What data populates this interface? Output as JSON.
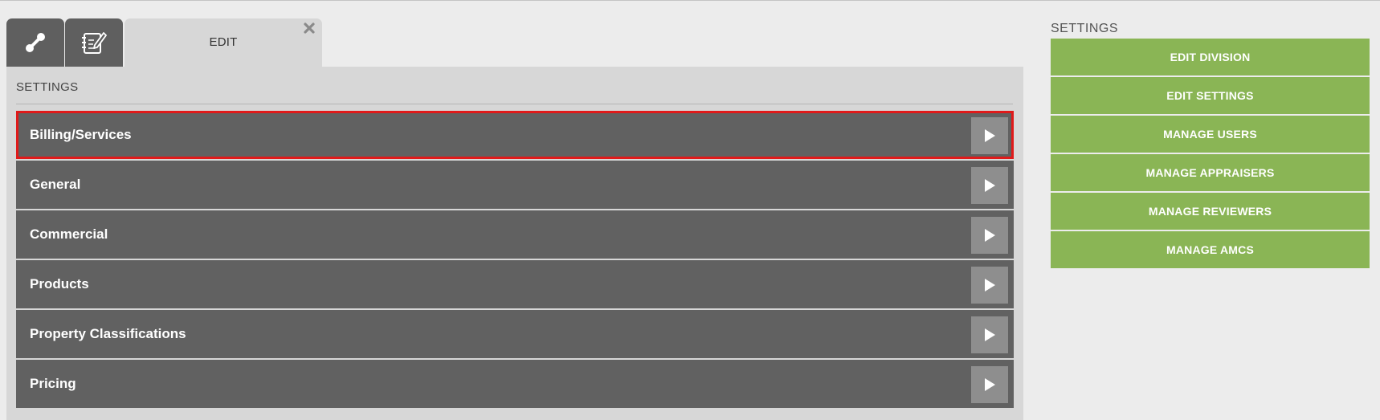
{
  "tabs": {
    "edit_label": "EDIT"
  },
  "icons": {
    "tab1": "link-tool-icon",
    "tab2": "notebook-pen-icon",
    "close": "close-icon",
    "row_arrow": "play-arrow-icon"
  },
  "panel": {
    "title": "SETTINGS",
    "items": [
      {
        "label": "Billing/Services"
      },
      {
        "label": "General"
      },
      {
        "label": "Commercial"
      },
      {
        "label": "Products"
      },
      {
        "label": "Property Classifications"
      },
      {
        "label": "Pricing"
      }
    ],
    "selected_item": "Billing/Services"
  },
  "sidebar": {
    "title": "SETTINGS",
    "buttons": [
      {
        "label": "EDIT DIVISION"
      },
      {
        "label": "EDIT SETTINGS"
      },
      {
        "label": "MANAGE USERS"
      },
      {
        "label": "MANAGE APPRAISERS"
      },
      {
        "label": "MANAGE REVIEWERS"
      },
      {
        "label": "MANAGE AMCS"
      }
    ]
  },
  "colors": {
    "background": "#ececec",
    "panel": "#d7d7d7",
    "row": "#616161",
    "row_arrow_box": "#8e8e8e",
    "selection_border": "#e01a1a",
    "sidebar_button": "#8ab555"
  }
}
